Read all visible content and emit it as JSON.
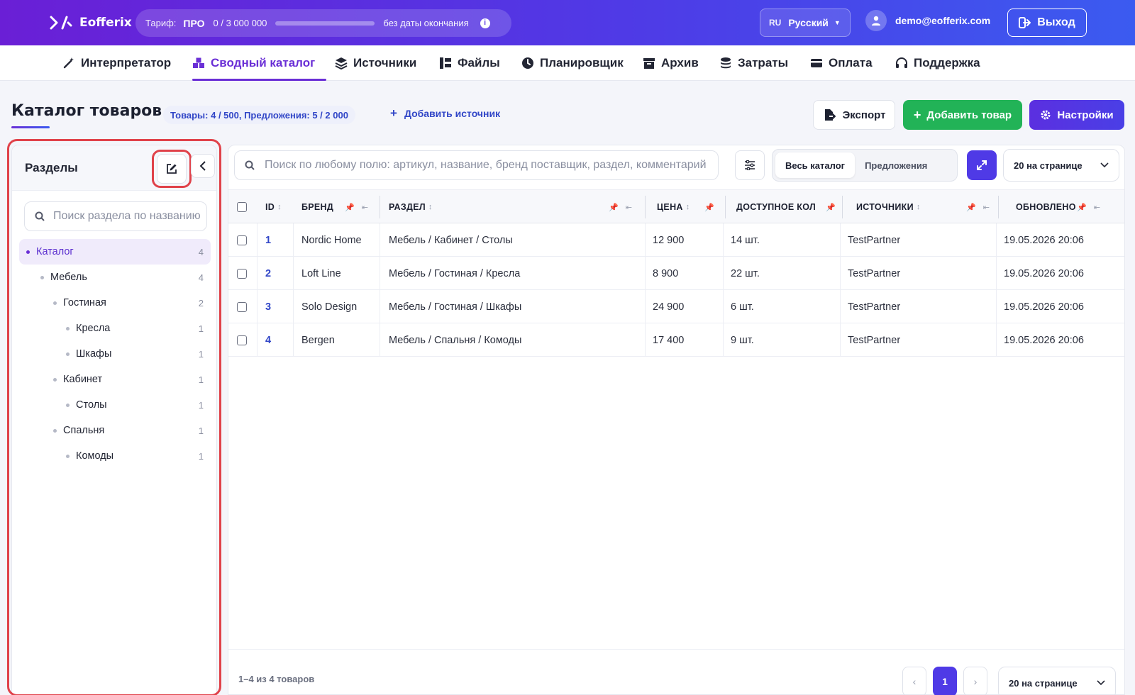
{
  "header": {
    "brand": "Eofferix",
    "tariff_label": "Тариф:",
    "tariff_plan": "ПРО",
    "tariff_usage": "0 / 3 000 000",
    "tariff_usage_fraction": 0,
    "tariff_expiry": "без даты окончания",
    "lang_code": "RU",
    "lang_name": "Русский",
    "user_email": "demo@eofferix.com",
    "logout_label": "Выход"
  },
  "nav": {
    "items": [
      {
        "label": "Интерпретатор",
        "icon": "magic-wand-icon"
      },
      {
        "label": "Сводный каталог",
        "icon": "boxes-icon",
        "active": true
      },
      {
        "label": "Источники",
        "icon": "layers-icon"
      },
      {
        "label": "Файлы",
        "icon": "folder-tree-icon"
      },
      {
        "label": "Планировщик",
        "icon": "clock-icon"
      },
      {
        "label": "Архив",
        "icon": "archive-icon"
      },
      {
        "label": "Затраты",
        "icon": "coins-icon"
      },
      {
        "label": "Оплата",
        "icon": "credit-card-icon"
      },
      {
        "label": "Поддержка",
        "icon": "headset-icon"
      }
    ]
  },
  "page": {
    "title": "Каталог товаров",
    "counts": "Товары: 4 / 500, Предложения: 5 / 2 000",
    "add_source": "Добавить источник",
    "export_label": "Экспорт",
    "add_product_label": "Добавить товар",
    "settings_label": "Настройки"
  },
  "sidebar": {
    "title": "Разделы",
    "search_placeholder": "Поиск раздела по названию",
    "tree": [
      {
        "label": "Каталог",
        "count": "4",
        "level": 0,
        "selected": true
      },
      {
        "label": "Мебель",
        "count": "4",
        "level": 1
      },
      {
        "label": "Гостиная",
        "count": "2",
        "level": 2
      },
      {
        "label": "Кресла",
        "count": "1",
        "level": 3
      },
      {
        "label": "Шкафы",
        "count": "1",
        "level": 3
      },
      {
        "label": "Кабинет",
        "count": "1",
        "level": 2
      },
      {
        "label": "Столы",
        "count": "1",
        "level": 3
      },
      {
        "label": "Спальня",
        "count": "1",
        "level": 2
      },
      {
        "label": "Комоды",
        "count": "1",
        "level": 3
      }
    ]
  },
  "toolbar": {
    "search_placeholder": "Поиск по любому полю: артикул, название, бренд поставщик, раздел, комментарий",
    "seg_all": "Весь каталог",
    "seg_offers": "Предложения",
    "per_page": "20 на странице"
  },
  "table": {
    "columns": [
      "ID",
      "БРЕНД",
      "РАЗДЕЛ",
      "ЦЕНА",
      "ДОСТУПНОЕ КОЛ",
      "ИСТОЧНИКИ",
      "ОБНОВЛЕНО"
    ],
    "rows": [
      {
        "id": "1",
        "brand": "Nordic Home",
        "section": "Мебель / Кабинет / Столы",
        "price": "12 900",
        "qty": "14 шт.",
        "source": "TestPartner",
        "updated": "19.05.2026 20:06"
      },
      {
        "id": "2",
        "brand": "Loft Line",
        "section": "Мебель / Гостиная / Кресла",
        "price": "8 900",
        "qty": "22 шт.",
        "source": "TestPartner",
        "updated": "19.05.2026 20:06"
      },
      {
        "id": "3",
        "brand": "Solo Design",
        "section": "Мебель / Гостиная / Шкафы",
        "price": "24 900",
        "qty": "6 шт.",
        "source": "TestPartner",
        "updated": "19.05.2026 20:06"
      },
      {
        "id": "4",
        "brand": "Bergen",
        "section": "Мебель / Спальня / Комоды",
        "price": "17 400",
        "qty": "9 шт.",
        "source": "TestPartner",
        "updated": "19.05.2026 20:06"
      }
    ]
  },
  "footer": {
    "summary": "1–4 из 4 товаров",
    "current_page": "1",
    "per_page": "20 на странице"
  },
  "colors": {
    "accent": "#4f3ae6",
    "brand_purple": "#6a2fd6",
    "success": "#22b357",
    "highlight": "#e0424a"
  }
}
